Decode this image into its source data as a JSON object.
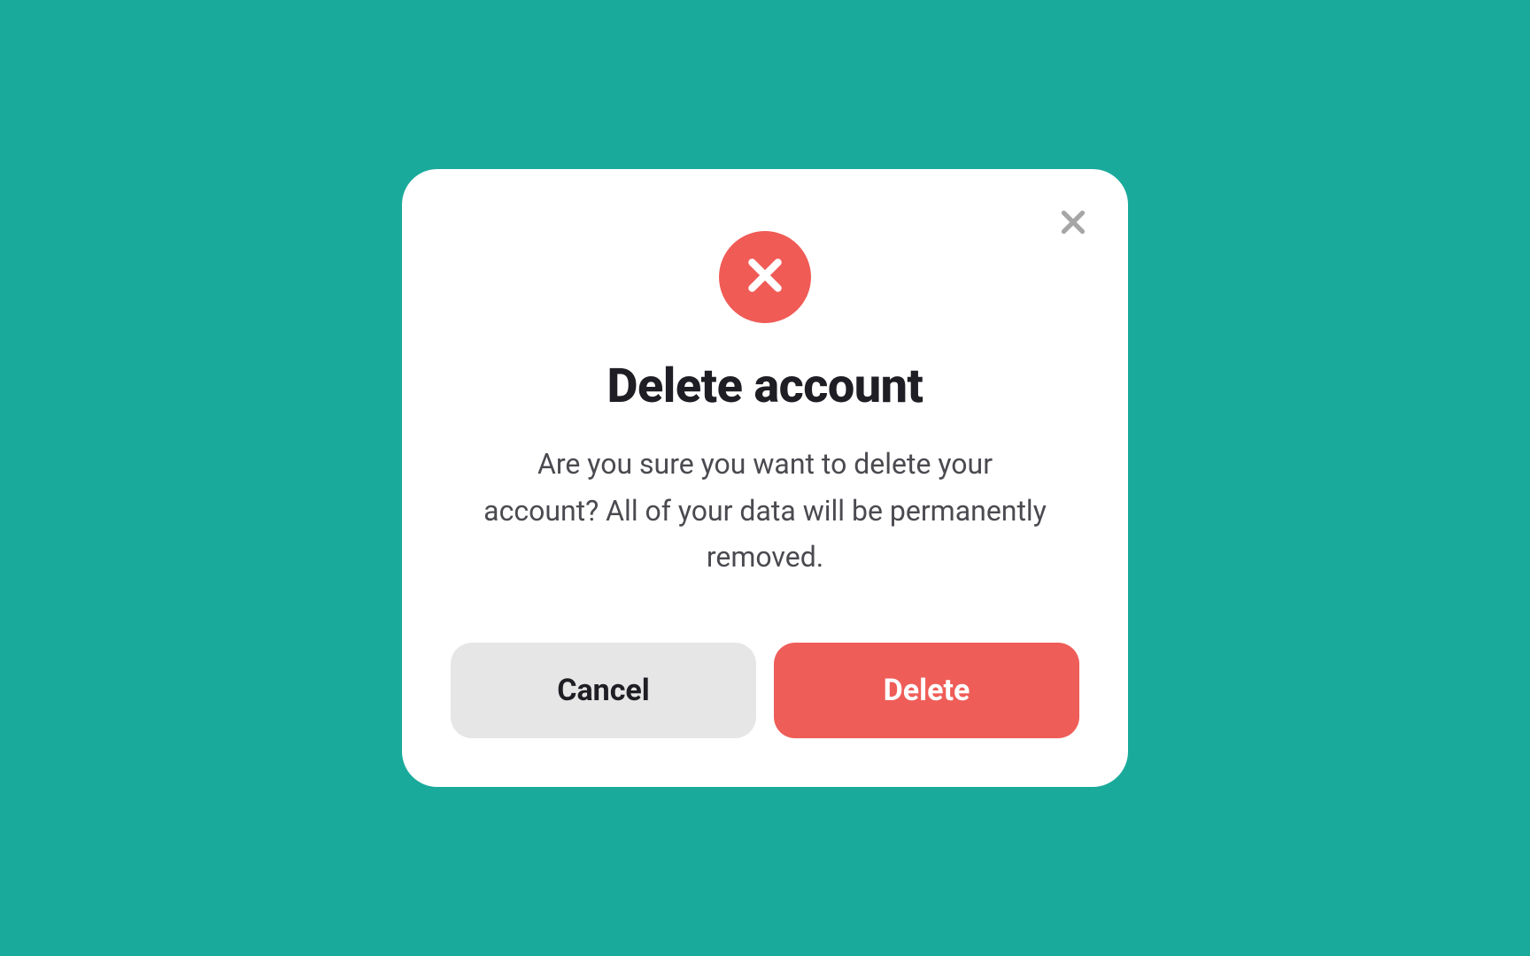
{
  "modal": {
    "title": "Delete account",
    "description": "Are you sure you want to delete your account? All of your data will be permanently removed.",
    "cancel_label": "Cancel",
    "delete_label": "Delete",
    "colors": {
      "background": "#1aaa9b",
      "danger": "#ef5d58",
      "icon_bg": "#f05b56",
      "cancel_bg": "#e6e6e6"
    }
  }
}
